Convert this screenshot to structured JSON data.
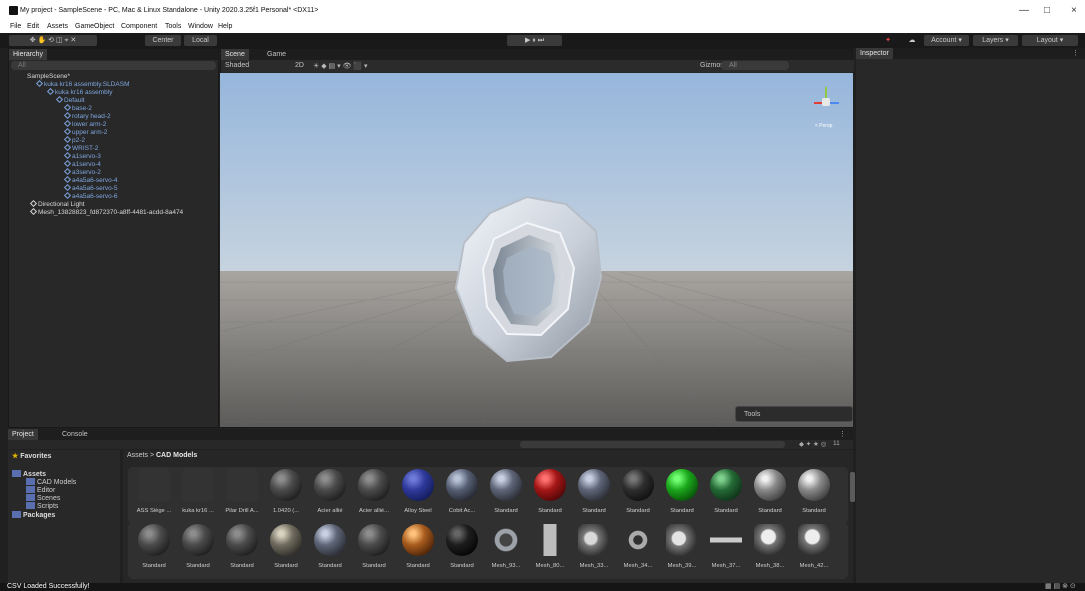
{
  "window": {
    "title": "My project - SampleScene - PC, Mac & Linux Standalone - Unity 2020.3.25f1 Personal* <DX11>",
    "controls": [
      "—",
      "□",
      "×"
    ]
  },
  "menu": [
    "File",
    "Edit",
    "Assets",
    "GameObject",
    "Component",
    "Tools",
    "Window",
    "Help"
  ],
  "toolbar": {
    "center": "Center",
    "local": "Local",
    "play_controls": [
      "▶",
      "⏸",
      "⏭"
    ],
    "account": "Account",
    "layers": "Layers",
    "layout": "Layout"
  },
  "hierarchy": {
    "tab": "Hierarchy",
    "search_placeholder": "All",
    "items": [
      {
        "label": "SampleScene*",
        "depth": 0
      },
      {
        "label": "kuka kr16 assembly.SLDASM",
        "depth": 1
      },
      {
        "label": "kuka kr16 assembly",
        "depth": 2
      },
      {
        "label": "Default",
        "depth": 3
      },
      {
        "label": "base-2",
        "depth": 4
      },
      {
        "label": "rotary head-2",
        "depth": 4
      },
      {
        "label": "lower arm-2",
        "depth": 4
      },
      {
        "label": "upper arm-2",
        "depth": 4
      },
      {
        "label": "p2-2",
        "depth": 4
      },
      {
        "label": "WRIST-2",
        "depth": 4
      },
      {
        "label": "a1servo-3",
        "depth": 4
      },
      {
        "label": "a1servo-4",
        "depth": 4
      },
      {
        "label": "a3servo-2",
        "depth": 4
      },
      {
        "label": "a4a5a6-servo-4",
        "depth": 4
      },
      {
        "label": "a4a5a6-servo-5",
        "depth": 4
      },
      {
        "label": "a4a5a6-servo-6",
        "depth": 4
      },
      {
        "label": "Directional Light",
        "depth": 1
      },
      {
        "label": "Mesh_13828823_fd872370-a8ff-4481-acdd-8a474",
        "depth": 1
      }
    ]
  },
  "scene": {
    "tabs": [
      "Scene",
      "Game"
    ],
    "shading": "Shaded",
    "mode_2d": "2D",
    "gizmos": "Gizmos",
    "search_placeholder": "All",
    "persp": "< Persp",
    "tools": "Tools"
  },
  "inspector": {
    "tab": "Inspector"
  },
  "project": {
    "tabs": [
      "Project",
      "Console"
    ],
    "favorites": "Favorites",
    "tree": [
      "Assets",
      "CAD Models",
      "Editor",
      "Scenes",
      "Scripts",
      "Packages"
    ],
    "breadcrumb": [
      "Assets",
      "CAD Models"
    ],
    "count": "11",
    "row1": [
      "ASS Siège ...",
      "kuka kr16 ...",
      "Pilar Drill A...",
      "1.0420 (...",
      "Acier allié",
      "Acier allié...",
      "Alloy Steel",
      "Cobit Ac...",
      "Standard",
      "Standard",
      "Standard",
      "Standard",
      "Standard",
      "Standard",
      "Standard",
      "Standard"
    ],
    "row2": [
      "Standard",
      "Standard",
      "Standard",
      "Standard",
      "Standard",
      "Standard",
      "Standard",
      "Standard",
      "Mesh_93...",
      "Mesh_80...",
      "Mesh_33...",
      "Mesh_34...",
      "Mesh_39...",
      "Mesh_37...",
      "Mesh_38...",
      "Mesh_42..."
    ]
  },
  "status": {
    "message": "CSV Loaded Successfully!"
  }
}
